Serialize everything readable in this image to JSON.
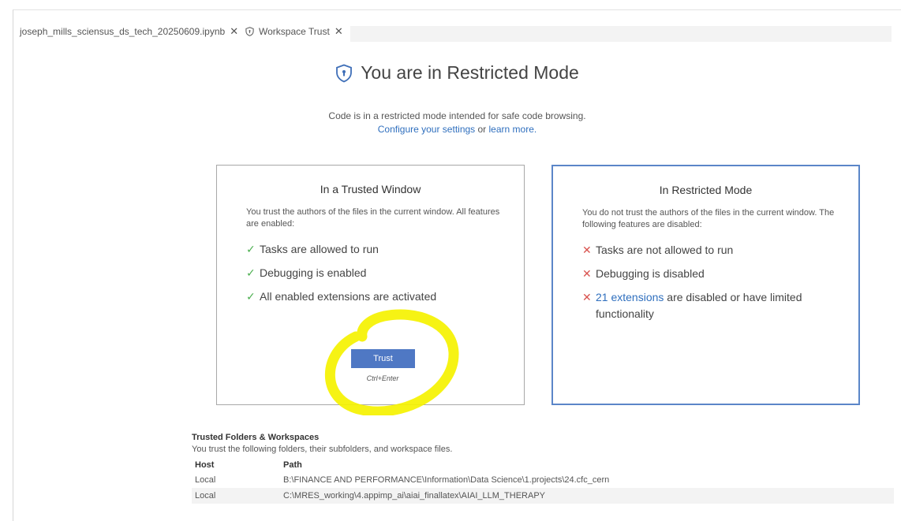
{
  "tabs": [
    {
      "label": "joseph_mills_sciensus_ds_tech_20250609.ipynb",
      "close": "✕"
    },
    {
      "label": "Workspace Trust",
      "close": "✕"
    }
  ],
  "hero": {
    "title": "You are in Restricted Mode",
    "description": "Code is in a restricted mode intended for safe code browsing.",
    "configure_link": "Configure your settings",
    "or_text": " or ",
    "learn_link": "learn more."
  },
  "trusted": {
    "title": "In a Trusted Window",
    "description": "You trust the authors of the files in the current window. All features are enabled:",
    "features": [
      "Tasks are allowed to run",
      "Debugging is enabled",
      "All enabled extensions are activated"
    ],
    "check_glyph": "✓",
    "button_label": "Trust",
    "button_shortcut": "Ctrl+Enter"
  },
  "restricted": {
    "title": "In Restricted Mode",
    "description": "You do not trust the authors of the files in the current window. The following features are disabled:",
    "features": [
      "Tasks are not allowed to run",
      "Debugging is disabled"
    ],
    "ext_link": "21 extensions",
    "ext_rest": " are disabled or have limited functionality",
    "cross_glyph": "✕"
  },
  "folders": {
    "title": "Trusted Folders & Workspaces",
    "description": "You trust the following folders, their subfolders, and workspace files.",
    "headers": {
      "host": "Host",
      "path": "Path"
    },
    "rows": [
      {
        "host": "Local",
        "path": "B:\\FINANCE AND PERFORMANCE\\Information\\Data Science\\1.projects\\24.cfc_cern"
      },
      {
        "host": "Local",
        "path": "C:\\MRES_working\\4.appimp_ai\\aiai_finallatex\\AIAI_LLM_THERAPY"
      }
    ]
  },
  "colors": {
    "accent": "#4f78c4",
    "link": "#2f6fbe",
    "check": "#4caf50",
    "cross": "#d9534f",
    "highlight": "#f5f200"
  }
}
